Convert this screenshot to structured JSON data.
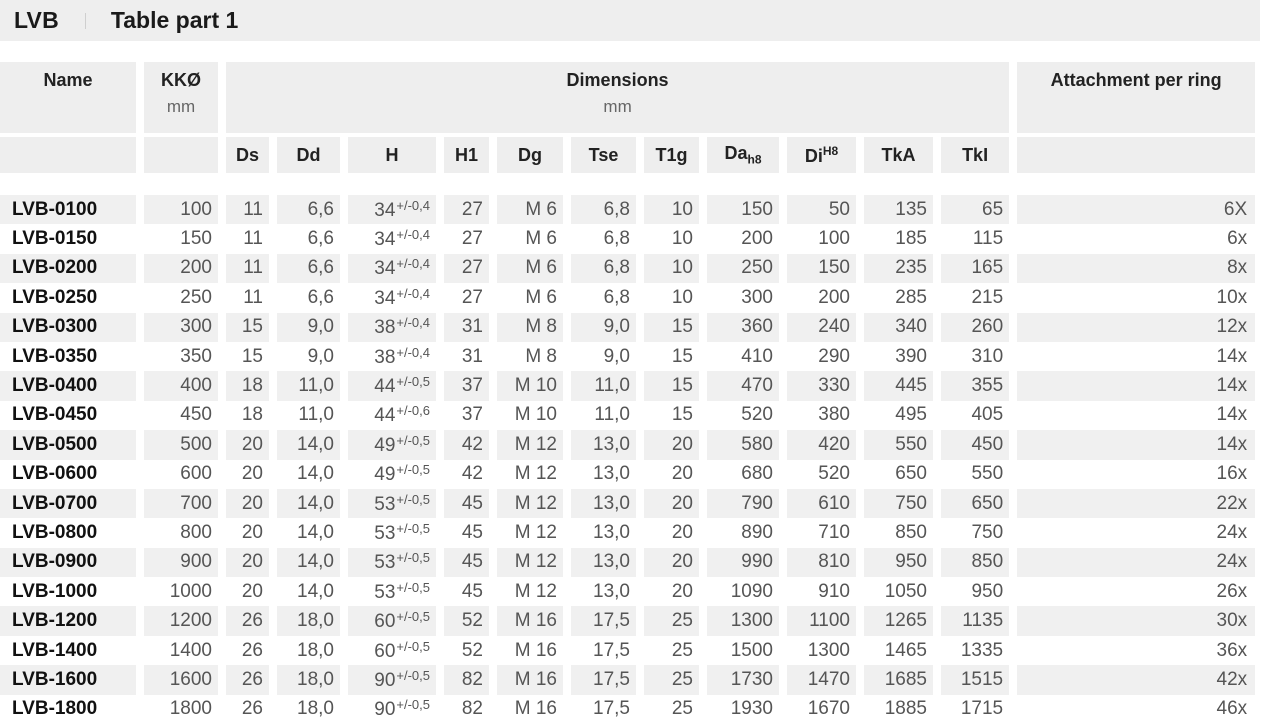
{
  "header": {
    "brand": "LVB",
    "subtitle": "Table part 1"
  },
  "table": {
    "groups": {
      "name": "Name",
      "kk": "KKØ",
      "kk_unit": "mm",
      "dimensions": "Dimensions",
      "dimensions_unit": "mm",
      "attachment": "Attachment per ring"
    },
    "columns": {
      "ds": "Ds",
      "dd": "Dd",
      "h": "H",
      "h1": "H1",
      "dg": "Dg",
      "tse": "Tse",
      "t1g": "T1g",
      "da": "Da",
      "da_sub": "h8",
      "di": "Di",
      "di_sup": "H8",
      "tka": "TkA",
      "tki": "TkI"
    },
    "rows": [
      {
        "name": "LVB-0100",
        "kk": "100",
        "ds": "11",
        "dd": "6,6",
        "h": "34",
        "h_tol": "+/-0,4",
        "h1": "27",
        "dg": "M 6",
        "tse": "6,8",
        "t1g": "10",
        "da": "150",
        "di": "50",
        "tka": "135",
        "tki": "65",
        "att": "6X"
      },
      {
        "name": "LVB-0150",
        "kk": "150",
        "ds": "11",
        "dd": "6,6",
        "h": "34",
        "h_tol": "+/-0,4",
        "h1": "27",
        "dg": "M 6",
        "tse": "6,8",
        "t1g": "10",
        "da": "200",
        "di": "100",
        "tka": "185",
        "tki": "115",
        "att": "6x"
      },
      {
        "name": "LVB-0200",
        "kk": "200",
        "ds": "11",
        "dd": "6,6",
        "h": "34",
        "h_tol": "+/-0,4",
        "h1": "27",
        "dg": "M 6",
        "tse": "6,8",
        "t1g": "10",
        "da": "250",
        "di": "150",
        "tka": "235",
        "tki": "165",
        "att": "8x"
      },
      {
        "name": "LVB-0250",
        "kk": "250",
        "ds": "11",
        "dd": "6,6",
        "h": "34",
        "h_tol": "+/-0,4",
        "h1": "27",
        "dg": "M 6",
        "tse": "6,8",
        "t1g": "10",
        "da": "300",
        "di": "200",
        "tka": "285",
        "tki": "215",
        "att": "10x"
      },
      {
        "name": "LVB-0300",
        "kk": "300",
        "ds": "15",
        "dd": "9,0",
        "h": "38",
        "h_tol": "+/-0,4",
        "h1": "31",
        "dg": "M 8",
        "tse": "9,0",
        "t1g": "15",
        "da": "360",
        "di": "240",
        "tka": "340",
        "tki": "260",
        "att": "12x"
      },
      {
        "name": "LVB-0350",
        "kk": "350",
        "ds": "15",
        "dd": "9,0",
        "h": "38",
        "h_tol": "+/-0,4",
        "h1": "31",
        "dg": "M 8",
        "tse": "9,0",
        "t1g": "15",
        "da": "410",
        "di": "290",
        "tka": "390",
        "tki": "310",
        "att": "14x"
      },
      {
        "name": "LVB-0400",
        "kk": "400",
        "ds": "18",
        "dd": "11,0",
        "h": "44",
        "h_tol": "+/-0,5",
        "h1": "37",
        "dg": "M 10",
        "tse": "11,0",
        "t1g": "15",
        "da": "470",
        "di": "330",
        "tka": "445",
        "tki": "355",
        "att": "14x"
      },
      {
        "name": "LVB-0450",
        "kk": "450",
        "ds": "18",
        "dd": "11,0",
        "h": "44",
        "h_tol": "+/-0,6",
        "h1": "37",
        "dg": "M 10",
        "tse": "11,0",
        "t1g": "15",
        "da": "520",
        "di": "380",
        "tka": "495",
        "tki": "405",
        "att": "14x"
      },
      {
        "name": "LVB-0500",
        "kk": "500",
        "ds": "20",
        "dd": "14,0",
        "h": "49",
        "h_tol": "+/-0,5",
        "h1": "42",
        "dg": "M 12",
        "tse": "13,0",
        "t1g": "20",
        "da": "580",
        "di": "420",
        "tka": "550",
        "tki": "450",
        "att": "14x"
      },
      {
        "name": "LVB-0600",
        "kk": "600",
        "ds": "20",
        "dd": "14,0",
        "h": "49",
        "h_tol": "+/-0,5",
        "h1": "42",
        "dg": "M 12",
        "tse": "13,0",
        "t1g": "20",
        "da": "680",
        "di": "520",
        "tka": "650",
        "tki": "550",
        "att": "16x"
      },
      {
        "name": "LVB-0700",
        "kk": "700",
        "ds": "20",
        "dd": "14,0",
        "h": "53",
        "h_tol": "+/-0,5",
        "h1": "45",
        "dg": "M 12",
        "tse": "13,0",
        "t1g": "20",
        "da": "790",
        "di": "610",
        "tka": "750",
        "tki": "650",
        "att": "22x"
      },
      {
        "name": "LVB-0800",
        "kk": "800",
        "ds": "20",
        "dd": "14,0",
        "h": "53",
        "h_tol": "+/-0,5",
        "h1": "45",
        "dg": "M 12",
        "tse": "13,0",
        "t1g": "20",
        "da": "890",
        "di": "710",
        "tka": "850",
        "tki": "750",
        "att": "24x"
      },
      {
        "name": "LVB-0900",
        "kk": "900",
        "ds": "20",
        "dd": "14,0",
        "h": "53",
        "h_tol": "+/-0,5",
        "h1": "45",
        "dg": "M 12",
        "tse": "13,0",
        "t1g": "20",
        "da": "990",
        "di": "810",
        "tka": "950",
        "tki": "850",
        "att": "24x"
      },
      {
        "name": "LVB-1000",
        "kk": "1000",
        "ds": "20",
        "dd": "14,0",
        "h": "53",
        "h_tol": "+/-0,5",
        "h1": "45",
        "dg": "M 12",
        "tse": "13,0",
        "t1g": "20",
        "da": "1090",
        "di": "910",
        "tka": "1050",
        "tki": "950",
        "att": "26x"
      },
      {
        "name": "LVB-1200",
        "kk": "1200",
        "ds": "26",
        "dd": "18,0",
        "h": "60",
        "h_tol": "+/-0,5",
        "h1": "52",
        "dg": "M 16",
        "tse": "17,5",
        "t1g": "25",
        "da": "1300",
        "di": "1100",
        "tka": "1265",
        "tki": "1135",
        "att": "30x"
      },
      {
        "name": "LVB-1400",
        "kk": "1400",
        "ds": "26",
        "dd": "18,0",
        "h": "60",
        "h_tol": "+/-0,5",
        "h1": "52",
        "dg": "M 16",
        "tse": "17,5",
        "t1g": "25",
        "da": "1500",
        "di": "1300",
        "tka": "1465",
        "tki": "1335",
        "att": "36x"
      },
      {
        "name": "LVB-1600",
        "kk": "1600",
        "ds": "26",
        "dd": "18,0",
        "h": "90",
        "h_tol": "+/-0,5",
        "h1": "82",
        "dg": "M 16",
        "tse": "17,5",
        "t1g": "25",
        "da": "1730",
        "di": "1470",
        "tka": "1685",
        "tki": "1515",
        "att": "42x"
      },
      {
        "name": "LVB-1800",
        "kk": "1800",
        "ds": "26",
        "dd": "18,0",
        "h": "90",
        "h_tol": "+/-0,5",
        "h1": "82",
        "dg": "M 16",
        "tse": "17,5",
        "t1g": "25",
        "da": "1930",
        "di": "1670",
        "tka": "1885",
        "tki": "1715",
        "att": "46x"
      }
    ]
  }
}
